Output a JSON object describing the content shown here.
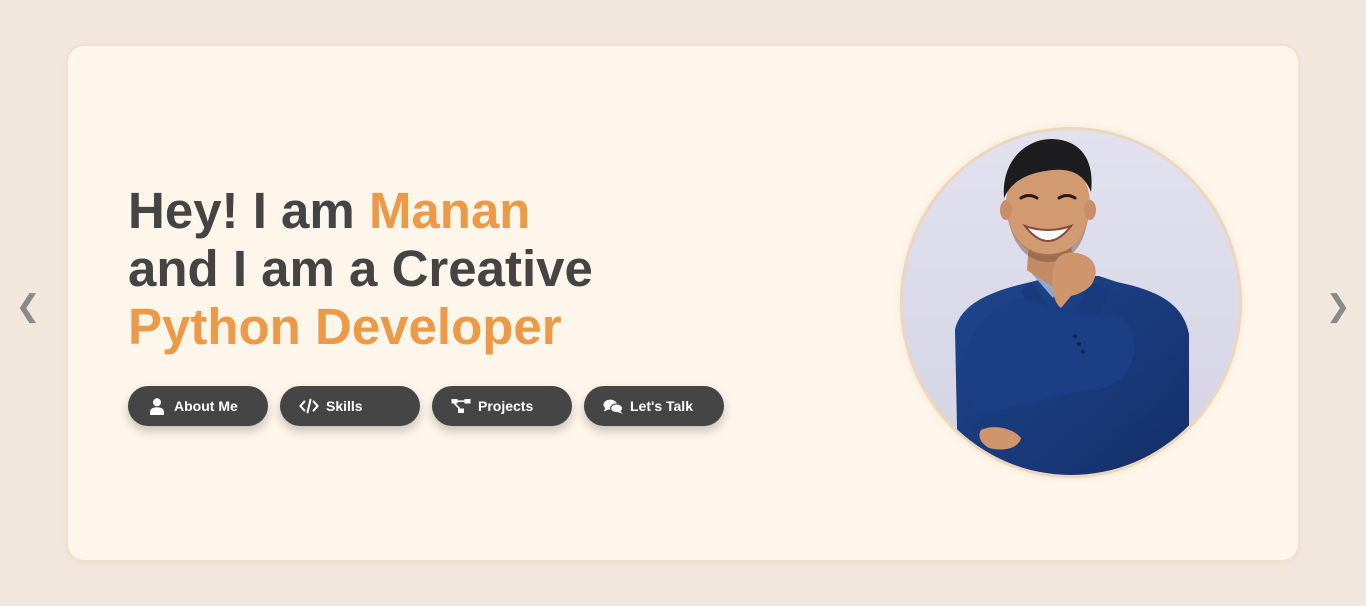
{
  "hero": {
    "line1_prefix": "Hey! I am ",
    "name": "Manan",
    "line2": "and I am a Creative",
    "role": "Python Developer"
  },
  "buttons": [
    {
      "label": "About Me",
      "icon": "user-icon"
    },
    {
      "label": "Skills",
      "icon": "code-icon"
    },
    {
      "label": "Projects",
      "icon": "sitemap-icon"
    },
    {
      "label": "Let's Talk",
      "icon": "chat-icon"
    }
  ],
  "navigation": {
    "prev": "❮",
    "next": "❯"
  },
  "profile_image": {
    "alt": "Smiling man in blue suit"
  },
  "colors": {
    "page_background": "#f2e7dc",
    "card_background": "#fef6ea",
    "heading_text": "#444444",
    "accent": "#ec9a48",
    "button_background": "#454545",
    "button_text": "#ffffff",
    "arrow": "#8a8a8a"
  }
}
